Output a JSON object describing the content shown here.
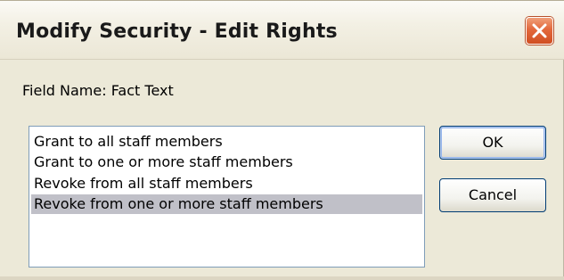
{
  "window": {
    "title": "Modify Security - Edit Rights"
  },
  "field": {
    "label": "Field Name: Fact Text"
  },
  "list": {
    "items": [
      {
        "label": "Grant to all staff members",
        "selected": false
      },
      {
        "label": "Grant to one or more staff members",
        "selected": false
      },
      {
        "label": "Revoke from all staff members",
        "selected": false
      },
      {
        "label": "Revoke from one or more staff members",
        "selected": true
      }
    ]
  },
  "buttons": {
    "ok_label": "OK",
    "cancel_label": "Cancel"
  },
  "icons": {
    "close": "close-icon"
  },
  "colors": {
    "dialog_bg": "#ece9d8",
    "selection": "#c0c0c8",
    "close_button": "#e3683c",
    "button_border": "#003c74"
  }
}
